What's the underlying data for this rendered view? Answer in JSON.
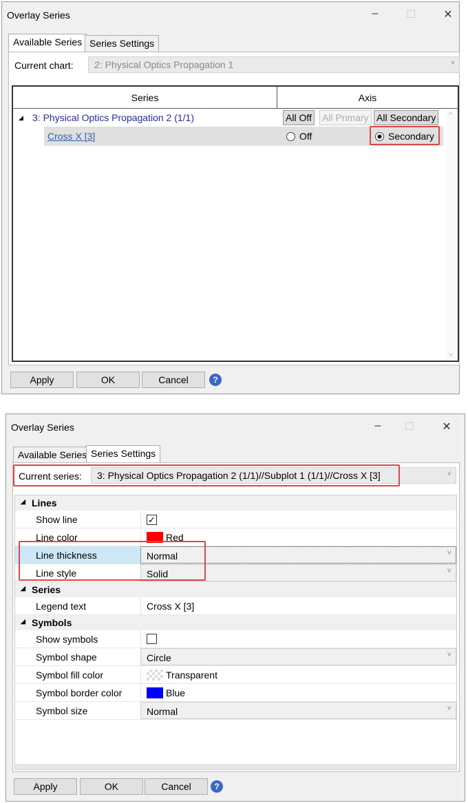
{
  "window1": {
    "title": "Overlay Series",
    "tabs": [
      "Available Series",
      "Series Settings"
    ],
    "current_chart_label": "Current chart:",
    "current_chart_value": "2: Physical Optics Propagation 1",
    "columns": [
      "Series",
      "Axis"
    ],
    "group": {
      "label": "3: Physical Optics Propagation 2 (1/1)",
      "buttons": [
        "All Off",
        "All Primary",
        "All Secondary"
      ]
    },
    "item": {
      "label": "Cross X [3]",
      "options": [
        "Off",
        "Secondary"
      ],
      "selected": "Secondary"
    },
    "buttons": {
      "apply": "Apply",
      "ok": "OK",
      "cancel": "Cancel",
      "help": "?"
    }
  },
  "window2": {
    "title": "Overlay Series",
    "tabs": [
      "Available Series",
      "Series Settings"
    ],
    "current_series_label": "Current series:",
    "current_series_value": "3: Physical Optics Propagation 2 (1/1)//Subplot 1 (1/1)//Cross X [3]",
    "categories": {
      "lines": "Lines",
      "series": "Series",
      "symbols": "Symbols"
    },
    "props": {
      "show_line": {
        "label": "Show line",
        "checked": true
      },
      "line_color": {
        "label": "Line color",
        "value": "Red",
        "color": "#ff0000"
      },
      "line_thickness": {
        "label": "Line thickness",
        "value": "Normal"
      },
      "line_style": {
        "label": "Line style",
        "value": "Solid"
      },
      "legend_text": {
        "label": "Legend text",
        "value": "Cross X [3]"
      },
      "show_symbols": {
        "label": "Show symbols",
        "checked": false
      },
      "symbol_shape": {
        "label": "Symbol shape",
        "value": "Circle"
      },
      "symbol_fill": {
        "label": "Symbol fill color",
        "value": "Transparent"
      },
      "symbol_border": {
        "label": "Symbol border color",
        "value": "Blue",
        "color": "#0000ff"
      },
      "symbol_size": {
        "label": "Symbol size",
        "value": "Normal"
      }
    },
    "buttons": {
      "apply": "Apply",
      "ok": "OK",
      "cancel": "Cancel",
      "help": "?"
    }
  }
}
